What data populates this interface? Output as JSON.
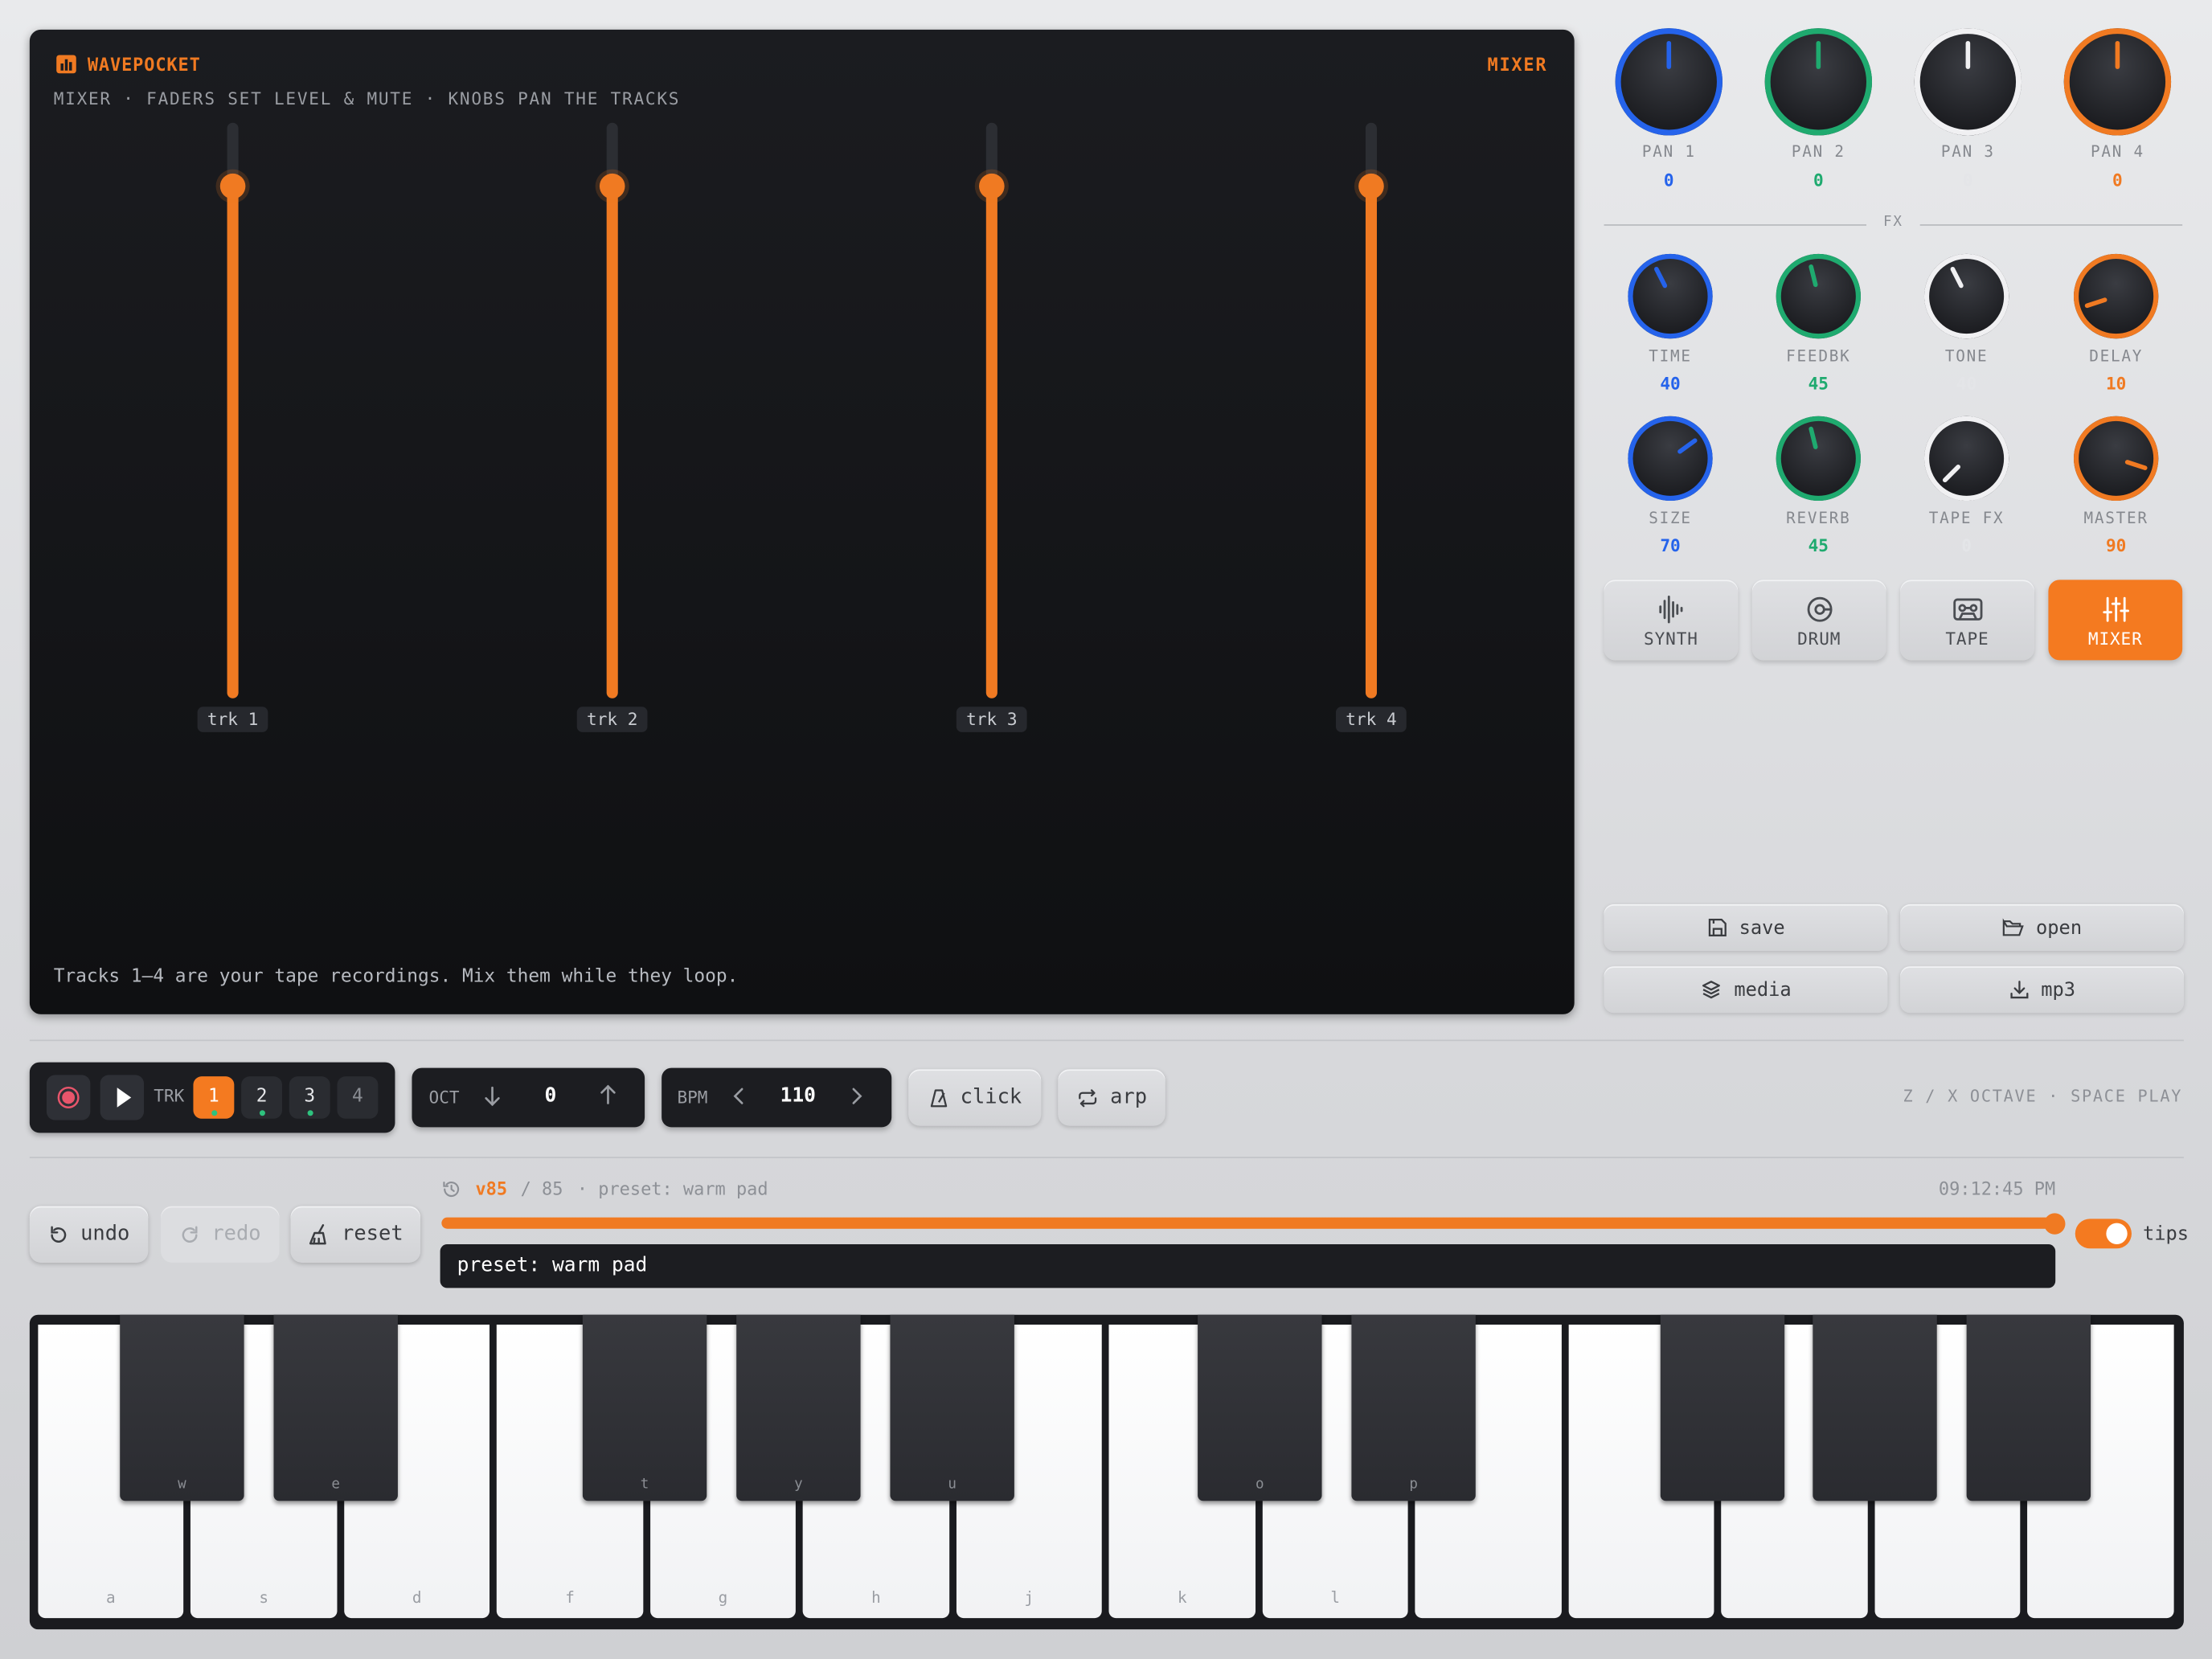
{
  "app": {
    "name": "WAVEPOCKET",
    "mode_title": "MIXER"
  },
  "screen": {
    "subtitle": "MIXER · FADERS SET LEVEL & MUTE · KNOBS PAN THE TRACKS",
    "hint": "Tracks 1–4 are your tape recordings. Mix them while they loop.",
    "faders": [
      {
        "label": "trk 1",
        "level": 0.89
      },
      {
        "label": "trk 2",
        "level": 0.89
      },
      {
        "label": "trk 3",
        "level": 0.89
      },
      {
        "label": "trk 4",
        "level": 0.89
      }
    ]
  },
  "colors": {
    "accent": "#f47a20",
    "blue": "#2563eb",
    "green": "#1faa6f",
    "white": "#f0f0f2",
    "orange": "#f07a22"
  },
  "knobs_pan": [
    {
      "name": "PAN 1",
      "value": "0",
      "color": "blue",
      "angle": 0
    },
    {
      "name": "PAN 2",
      "value": "0",
      "color": "green",
      "angle": 0
    },
    {
      "name": "PAN 3",
      "value": "0",
      "color": "white",
      "angle": 0
    },
    {
      "name": "PAN 4",
      "value": "0",
      "color": "orange",
      "angle": 0
    }
  ],
  "fx_label": "FX",
  "knobs_fx": [
    {
      "name": "TIME",
      "value": "40",
      "color": "blue",
      "angle": -27
    },
    {
      "name": "FEEDBK",
      "value": "45",
      "color": "green",
      "angle": -14
    },
    {
      "name": "TONE",
      "value": "40",
      "color": "white",
      "angle": -27
    },
    {
      "name": "DELAY",
      "value": "10",
      "color": "orange",
      "angle": -108
    },
    {
      "name": "SIZE",
      "value": "70",
      "color": "blue",
      "angle": 54
    },
    {
      "name": "REVERB",
      "value": "45",
      "color": "green",
      "angle": -14
    },
    {
      "name": "TAPE FX",
      "value": "0",
      "color": "white",
      "angle": -135
    },
    {
      "name": "MASTER",
      "value": "90",
      "color": "orange",
      "angle": 108
    }
  ],
  "mode_buttons": [
    {
      "label": "SYNTH",
      "icon": "waveform-icon",
      "active": false
    },
    {
      "label": "DRUM",
      "icon": "drum-icon",
      "active": false
    },
    {
      "label": "TAPE",
      "icon": "cassette-icon",
      "active": false
    },
    {
      "label": "MIXER",
      "icon": "sliders-icon",
      "active": true
    }
  ],
  "file_buttons": {
    "save": "save",
    "open": "open",
    "media": "media",
    "mp3": "mp3"
  },
  "transport": {
    "trk_label": "TRK",
    "tracks": [
      {
        "label": "1",
        "active": true,
        "recorded": true
      },
      {
        "label": "2",
        "active": false,
        "recorded": true
      },
      {
        "label": "3",
        "active": false,
        "recorded": true
      },
      {
        "label": "4",
        "active": false,
        "recorded": false
      }
    ],
    "oct_label": "OCT",
    "oct_value": "0",
    "bpm_label": "BPM",
    "bpm_value": "110",
    "click_label": "click",
    "arp_label": "arp",
    "shortcuts": "Z / X OCTAVE · SPACE PLAY"
  },
  "history": {
    "undo": "undo",
    "redo": "redo",
    "reset": "reset",
    "version": "v85",
    "total": "/ 85",
    "preset_note": "· preset: warm pad",
    "time": "09:12:45 PM",
    "position": 1.0,
    "console": "preset: warm pad",
    "tips_label": "tips",
    "tips_on": true
  },
  "keyboard": {
    "white_keys": [
      "a",
      "s",
      "d",
      "f",
      "g",
      "h",
      "j",
      "k",
      "l",
      "",
      "",
      "",
      "",
      ""
    ],
    "black_keys": [
      "w",
      "e",
      "",
      "t",
      "y",
      "u",
      "",
      "o",
      "p",
      "",
      "",
      "",
      ""
    ]
  }
}
